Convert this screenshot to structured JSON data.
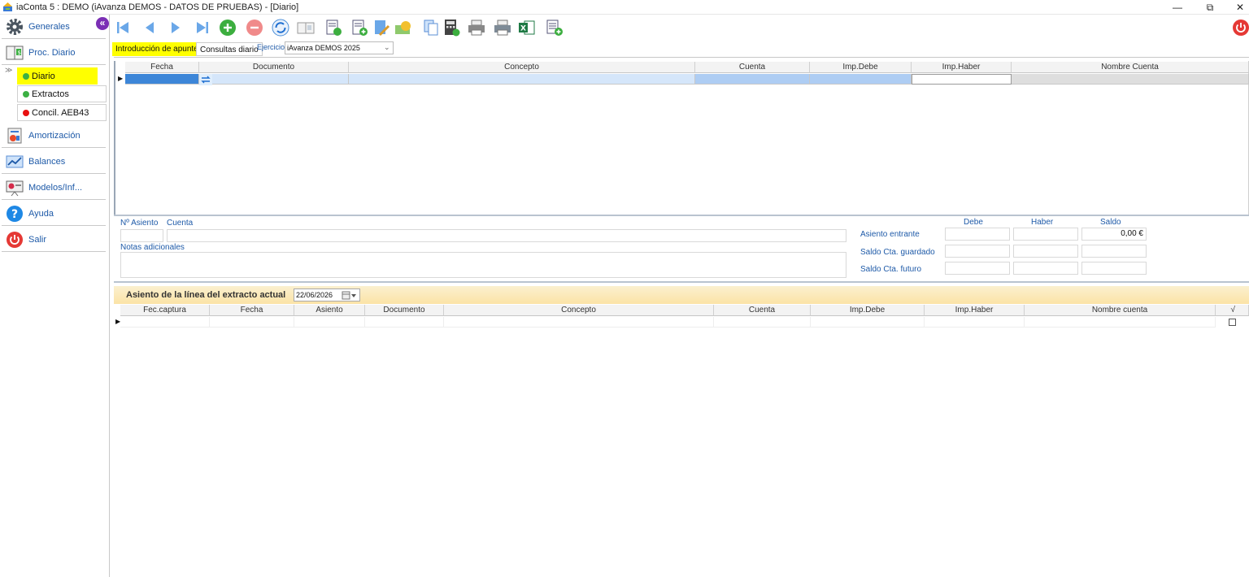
{
  "window": {
    "title": "iaConta 5 : DEMO (iAvanza DEMOS - DATOS DE PRUEBAS) - [Diario]",
    "minimize": "—",
    "restore": "⧉",
    "close": "✕"
  },
  "sidebar": {
    "items": [
      {
        "label": "Generales",
        "icon": "gear-icon"
      },
      {
        "label": "Proc. Diario",
        "icon": "ledger-icon"
      },
      {
        "label": "Amortización",
        "icon": "amortization-icon"
      },
      {
        "label": "Balances",
        "icon": "chart-icon"
      },
      {
        "label": "Modelos/Inf...",
        "icon": "presentation-icon"
      },
      {
        "label": "Ayuda",
        "icon": "help-icon"
      },
      {
        "label": "Salir",
        "icon": "power-icon"
      }
    ],
    "subitems": [
      {
        "label": "Diario",
        "color": "#3cb043"
      },
      {
        "label": "Extractos",
        "color": "#3cb043"
      },
      {
        "label": "Concil. AEB43",
        "color": "#e81010"
      }
    ],
    "collapse_glyph": "«"
  },
  "tabs": {
    "entry": "Introducción de apuntes",
    "query": "Consultas diario",
    "exercise_label": "Ejercicio",
    "exercise_value": "iAvanza DEMOS 2025"
  },
  "entry_grid": {
    "columns": [
      "Fecha",
      "Documento",
      "Concepto",
      "Cuenta",
      "Imp.Debe",
      "Imp.Haber",
      "Nombre Cuenta"
    ]
  },
  "entry_form": {
    "asiento_label": "Nº Asiento",
    "cuenta_label": "Cuenta",
    "notas_label": "Notas adicionales",
    "debe_label": "Debe",
    "haber_label": "Haber",
    "saldo_label": "Saldo",
    "asiento_entrante": "Asiento entrante",
    "saldo_guardado": "Saldo Cta. guardado",
    "saldo_futuro": "Saldo Cta. futuro",
    "saldo_value": "0,00 €"
  },
  "extract": {
    "title": "Asiento de la línea del extracto actual",
    "date": "22/06/2026",
    "columns": [
      "Fec.captura",
      "Fecha",
      "Asiento",
      "Documento",
      "Concepto",
      "Cuenta",
      "Imp.Debe",
      "Imp.Haber",
      "Nombre cuenta",
      "√"
    ]
  },
  "colors": {
    "highlight": "#ffff00",
    "link_blue": "#1e5aa8",
    "selected_cell": "#3d86d8",
    "light_cell": "#c6dcf7",
    "band": "#fbe9b5"
  }
}
